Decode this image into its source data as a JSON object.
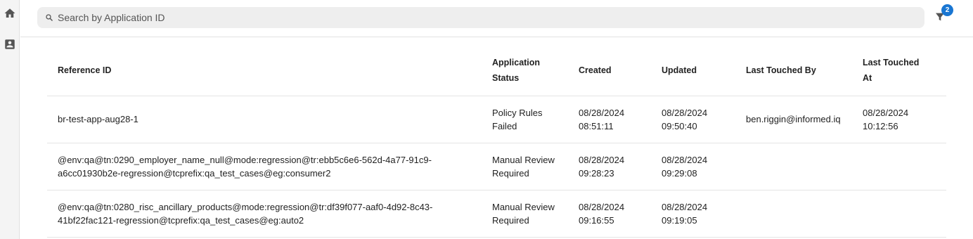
{
  "sidebar": {
    "items": [
      {
        "icon": "home-icon"
      },
      {
        "icon": "contact-card-icon"
      }
    ]
  },
  "search": {
    "placeholder": "Search by Application ID",
    "value": ""
  },
  "filter": {
    "icon": "filter-icon",
    "badge_count": "2",
    "badge_color": "#1976d2"
  },
  "table": {
    "headers": {
      "reference_id": "Reference ID",
      "status_line1": "Application",
      "status_line2": "Status",
      "created": "Created",
      "updated": "Updated",
      "last_touched_by": "Last Touched By",
      "last_touched_at_line1": "Last Touched",
      "last_touched_at_line2": "At"
    },
    "rows": [
      {
        "reference_id": "br-test-app-aug28-1",
        "status_line1": "Policy Rules",
        "status_line2": "Failed",
        "created_date": "08/28/2024",
        "created_time": "08:51:11",
        "updated_date": "08/28/2024",
        "updated_time": "09:50:40",
        "last_touched_by": "ben.riggin@informed.iq",
        "last_touched_at_date": "08/28/2024",
        "last_touched_at_time": "10:12:56"
      },
      {
        "reference_id_line1": "@env:qa@tn:0290_employer_name_null@mode:regression@tr:ebb5c6e6-562d-4a77-91c9-",
        "reference_id_line2": "a6cc01930b2e-regression@tcprefix:qa_test_cases@eg:consumer2",
        "status_line1": "Manual Review",
        "status_line2": "Required",
        "created_date": "08/28/2024",
        "created_time": "09:28:23",
        "updated_date": "08/28/2024",
        "updated_time": "09:29:08",
        "last_touched_by": "",
        "last_touched_at_date": "",
        "last_touched_at_time": ""
      },
      {
        "reference_id_line1": "@env:qa@tn:0280_risc_ancillary_products@mode:regression@tr:df39f077-aaf0-4d92-8c43-",
        "reference_id_line2": "41bf22fac121-regression@tcprefix:qa_test_cases@eg:auto2",
        "status_line1": "Manual Review",
        "status_line2": "Required",
        "created_date": "08/28/2024",
        "created_time": "09:16:55",
        "updated_date": "08/28/2024",
        "updated_time": "09:19:05",
        "last_touched_by": "",
        "last_touched_at_date": "",
        "last_touched_at_time": ""
      }
    ]
  }
}
